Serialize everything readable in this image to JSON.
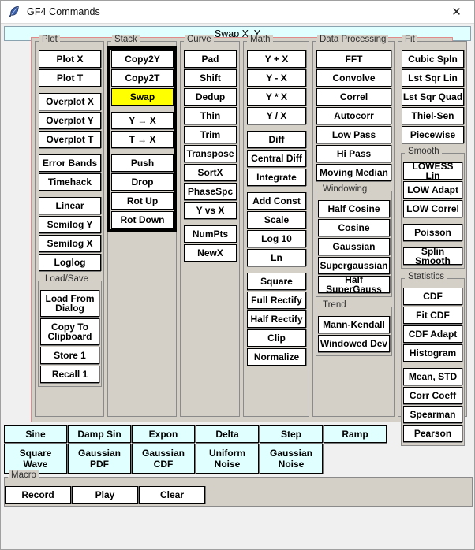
{
  "window": {
    "title": "GF4 Commands",
    "icon": "feather-quill-icon",
    "close_label": "✕"
  },
  "command_bar": {
    "text": "Swap X, Y"
  },
  "colors": {
    "selected_button": "#ffff00",
    "function_button": "#e0ffff",
    "panel_border": "#e08a8a",
    "panel_background": "#d4d0c8",
    "focus_border": "#000000"
  },
  "groups": [
    {
      "name": "plot",
      "legend": "Plot",
      "buttons": [
        {
          "label": "Plot X",
          "gap_before": 0
        },
        {
          "label": "Plot T",
          "gap_before": 0
        },
        {
          "label": "Overplot X",
          "gap_before": 1
        },
        {
          "label": "Overplot Y",
          "gap_before": 0
        },
        {
          "label": "Overplot T",
          "gap_before": 0
        },
        {
          "label": "Error Bands",
          "gap_before": 1
        },
        {
          "label": "Timehack",
          "gap_before": 0
        },
        {
          "label": "Linear",
          "gap_before": 1
        },
        {
          "label": "Semilog Y",
          "gap_before": 0
        },
        {
          "label": "Semilog X",
          "gap_before": 0
        },
        {
          "label": "Loglog",
          "gap_before": 0
        }
      ],
      "subgroups": [
        {
          "name": "load-save",
          "legend": "Load/Save",
          "buttons": [
            {
              "label": "Load From\nDialog",
              "tall": true
            },
            {
              "label": "Copy To\nClipboard",
              "tall": true
            },
            {
              "label": "Store 1"
            },
            {
              "label": "Recall 1"
            }
          ]
        }
      ]
    },
    {
      "name": "stack",
      "legend": "Stack",
      "focused": true,
      "buttons": [
        {
          "label": "Copy2Y",
          "gap_before": 0
        },
        {
          "label": "Copy2T",
          "gap_before": 0
        },
        {
          "label": "Swap",
          "gap_before": 0,
          "selected": true
        },
        {
          "label": "Y → X",
          "gap_before": 1
        },
        {
          "label": "T → X",
          "gap_before": 0
        },
        {
          "label": "Push",
          "gap_before": 1
        },
        {
          "label": "Drop",
          "gap_before": 0
        },
        {
          "label": "Rot Up",
          "gap_before": 0
        },
        {
          "label": "Rot Down",
          "gap_before": 0
        }
      ],
      "subgroups": []
    },
    {
      "name": "curve",
      "legend": "Curve",
      "buttons": [
        {
          "label": "Pad",
          "gap_before": 0
        },
        {
          "label": "Shift",
          "gap_before": 0
        },
        {
          "label": "Dedup",
          "gap_before": 0
        },
        {
          "label": "Thin",
          "gap_before": 0
        },
        {
          "label": "Trim",
          "gap_before": 0
        },
        {
          "label": "Transpose",
          "gap_before": 0
        },
        {
          "label": "SortX",
          "gap_before": 0
        },
        {
          "label": "PhaseSpc",
          "gap_before": 0
        },
        {
          "label": "Y vs X",
          "gap_before": 0
        },
        {
          "label": "NumPts",
          "gap_before": 1
        },
        {
          "label": "NewX",
          "gap_before": 0
        }
      ],
      "subgroups": []
    },
    {
      "name": "math",
      "legend": "Math",
      "buttons": [
        {
          "label": "Y + X",
          "gap_before": 0
        },
        {
          "label": "Y - X",
          "gap_before": 0
        },
        {
          "label": "Y * X",
          "gap_before": 0
        },
        {
          "label": "Y / X",
          "gap_before": 0
        },
        {
          "label": "Diff",
          "gap_before": 1
        },
        {
          "label": "Central Diff",
          "gap_before": 0
        },
        {
          "label": "Integrate",
          "gap_before": 0
        },
        {
          "label": "Add Const",
          "gap_before": 1
        },
        {
          "label": "Scale",
          "gap_before": 0
        },
        {
          "label": "Log 10",
          "gap_before": 0
        },
        {
          "label": "Ln",
          "gap_before": 0
        },
        {
          "label": "Square",
          "gap_before": 1
        },
        {
          "label": "Full Rectify",
          "gap_before": 0
        },
        {
          "label": "Half Rectify",
          "gap_before": 0
        },
        {
          "label": "Clip",
          "gap_before": 0
        },
        {
          "label": "Normalize",
          "gap_before": 0
        }
      ],
      "subgroups": []
    },
    {
      "name": "data-processing",
      "legend": "Data Processing",
      "buttons": [
        {
          "label": "FFT",
          "gap_before": 0
        },
        {
          "label": "Convolve",
          "gap_before": 0
        },
        {
          "label": "Correl",
          "gap_before": 0
        },
        {
          "label": "Autocorr",
          "gap_before": 0
        },
        {
          "label": "Low Pass",
          "gap_before": 0
        },
        {
          "label": "Hi Pass",
          "gap_before": 0
        },
        {
          "label": "Moving Median",
          "gap_before": 0
        }
      ],
      "subgroups": [
        {
          "name": "windowing",
          "legend": "Windowing",
          "buttons": [
            {
              "label": "Half Cosine"
            },
            {
              "label": "Cosine"
            },
            {
              "label": "Gaussian"
            },
            {
              "label": "Supergaussian"
            },
            {
              "label": "Half SuperGauss"
            }
          ]
        },
        {
          "name": "trend",
          "legend": "Trend",
          "buttons": [
            {
              "label": "Mann-Kendall"
            },
            {
              "label": "Windowed Dev"
            }
          ]
        }
      ]
    },
    {
      "name": "fit",
      "legend": "Fit",
      "buttons": [
        {
          "label": "Cubic Spln",
          "gap_before": 0
        },
        {
          "label": "Lst Sqr Lin",
          "gap_before": 0
        },
        {
          "label": "Lst Sqr Quad",
          "gap_before": 0
        },
        {
          "label": "Thiel-Sen",
          "gap_before": 0
        },
        {
          "label": "Piecewise",
          "gap_before": 0
        }
      ],
      "subgroups": [
        {
          "name": "smooth",
          "legend": "Smooth",
          "buttons": [
            {
              "label": "LOWESS Lin"
            },
            {
              "label": "LOW Adapt"
            },
            {
              "label": "LOW Correl"
            },
            {
              "label": "Poisson",
              "gap_before": 1
            },
            {
              "label": "Splin Smooth",
              "gap_before": 1
            }
          ]
        },
        {
          "name": "statistics",
          "legend": "Statistics",
          "buttons": [
            {
              "label": "CDF"
            },
            {
              "label": "Fit CDF"
            },
            {
              "label": "CDF Adapt"
            },
            {
              "label": "Histogram"
            },
            {
              "label": "Mean, STD",
              "gap_before": 1
            },
            {
              "label": "Corr Coeff"
            },
            {
              "label": "Spearman"
            },
            {
              "label": "Pearson"
            }
          ]
        }
      ]
    }
  ],
  "function_rows": [
    {
      "name": "function-row-1",
      "buttons": [
        {
          "label": "Sine"
        },
        {
          "label": "Damp Sin"
        },
        {
          "label": "Expon"
        },
        {
          "label": "Delta"
        },
        {
          "label": "Step"
        },
        {
          "label": "Ramp"
        }
      ]
    },
    {
      "name": "function-row-2",
      "buttons": [
        {
          "label": "Square\nWave"
        },
        {
          "label": "Gaussian\nPDF"
        },
        {
          "label": "Gaussian\nCDF"
        },
        {
          "label": "Uniform\nNoise"
        },
        {
          "label": "Gaussian\nNoise"
        }
      ]
    }
  ],
  "macro": {
    "legend": "Macro",
    "buttons": [
      {
        "label": "Record"
      },
      {
        "label": "Play"
      },
      {
        "label": "Clear"
      }
    ]
  }
}
